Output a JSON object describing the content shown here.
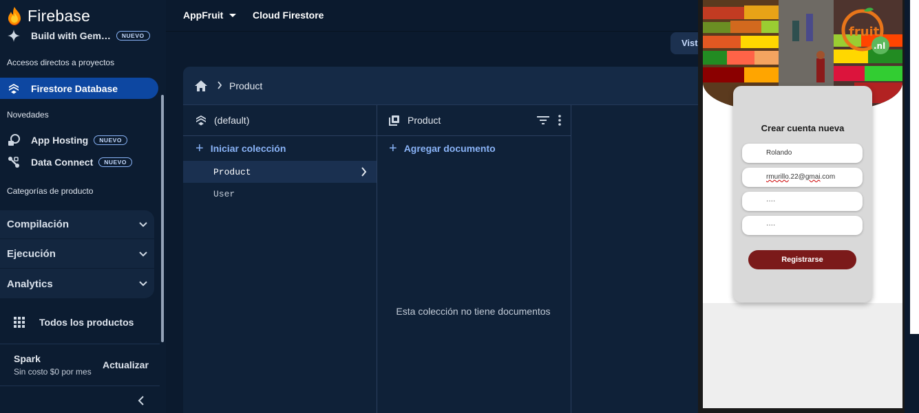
{
  "brand": {
    "name": "Firebase"
  },
  "sidebar": {
    "gemini": {
      "label": "Build with Gem…",
      "badge": "NUEVO"
    },
    "shortcuts_label": "Accesos directos a proyectos",
    "active": {
      "label": "Firestore Database"
    },
    "news_label": "Novedades",
    "app_hosting": {
      "label": "App Hosting",
      "badge": "NUEVO"
    },
    "data_connect": {
      "label": "Data Connect",
      "badge": "NUEVO"
    },
    "categories_label": "Categorías de producto",
    "groups": [
      {
        "label": "Compilación"
      },
      {
        "label": "Ejecución"
      },
      {
        "label": "Analytics"
      }
    ],
    "all_products": "Todos los productos",
    "plan": {
      "name": "Spark",
      "desc": "Sin costo $0 por mes",
      "upgrade": "Actualizar"
    }
  },
  "topbar": {
    "project": "AppFruit",
    "product": "Cloud Firestore",
    "visit": "Vist"
  },
  "firestore": {
    "breadcrumb": "Product",
    "db_column": {
      "title": "(default)",
      "action": "Iniciar colección",
      "collections": [
        {
          "name": "Product",
          "selected": true
        },
        {
          "name": "User",
          "selected": false
        }
      ]
    },
    "collection_column": {
      "title": "Product",
      "action": "Agregar documento",
      "empty": "Esta colección no tiene documentos"
    }
  },
  "app": {
    "logo_text": "fruit",
    "logo_suffix": ".nl",
    "title": "Crear cuenta nueva",
    "name_value": "Rolando",
    "email_user": "rmurillo",
    "email_rest": ".22@",
    "email_domain": "gmai",
    "email_tld": ".com",
    "password": "····",
    "confirm_password": "····",
    "register": "Registrarse"
  },
  "colors": {
    "sidebar_active": "#0d47a1",
    "link": "#8ab4f8",
    "register_button": "#7b1a1a"
  }
}
